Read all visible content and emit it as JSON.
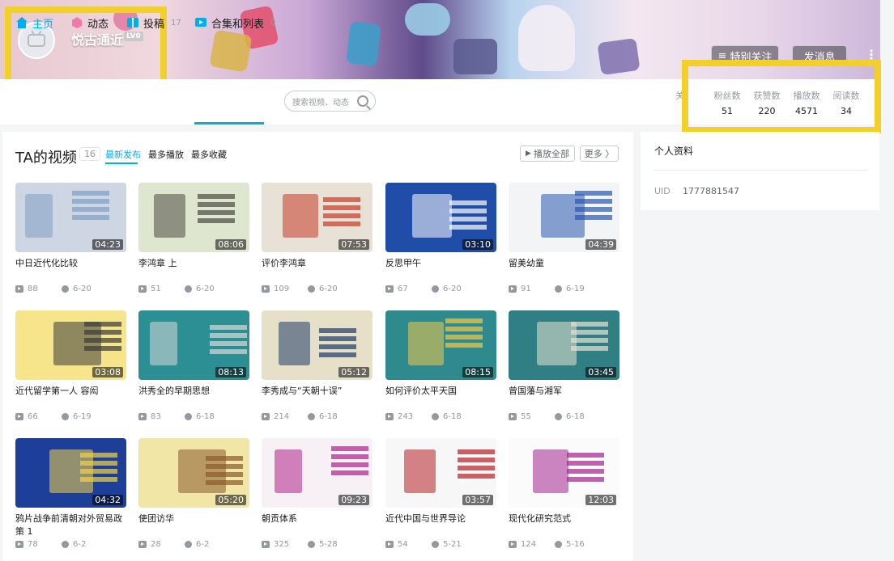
{
  "header": {
    "username": "悦古通近",
    "level": "LV0",
    "follow_label": "特别关注",
    "message_label": "发消息",
    "more_icon": "more-dots-icon"
  },
  "nav": {
    "items": [
      {
        "label": "主页",
        "icon": "home-icon",
        "count": ""
      },
      {
        "label": "动态",
        "icon": "dynamic-icon",
        "count": ""
      },
      {
        "label": "投稿",
        "icon": "upload-icon",
        "count": "17"
      },
      {
        "label": "合集和列表",
        "icon": "collection-icon",
        "count": "0"
      }
    ],
    "search_placeholder": "搜索视频、动态",
    "follow_cut": "关"
  },
  "stats": [
    {
      "label": "粉丝数",
      "value": "51"
    },
    {
      "label": "获赞数",
      "value": "220"
    },
    {
      "label": "播放数",
      "value": "4571"
    },
    {
      "label": "阅读数",
      "value": "34"
    }
  ],
  "videos_section": {
    "title": "TA的视频",
    "count": "16",
    "sort_tabs": [
      "最新发布",
      "最多播放",
      "最多收藏"
    ],
    "play_all_label": "播放全部",
    "more_label": "更多 〉"
  },
  "videos": [
    {
      "title": "中日近代化比较",
      "duration": "04:23",
      "plays": "88",
      "date": "6-20",
      "bg": "#cfd6e3",
      "accent": "#7f9fc7"
    },
    {
      "title": "李鸿章 上",
      "duration": "08:06",
      "plays": "51",
      "date": "6-20",
      "bg": "#dfe6cf",
      "accent": "#4a4a44"
    },
    {
      "title": "评价李鸿章",
      "duration": "07:53",
      "plays": "109",
      "date": "6-20",
      "bg": "#e8e2d6",
      "accent": "#c73b2a"
    },
    {
      "title": "反思甲午",
      "duration": "03:10",
      "plays": "67",
      "date": "6-20",
      "bg": "#1f4da8",
      "accent": "#ffffff"
    },
    {
      "title": "留美幼童",
      "duration": "04:39",
      "plays": "91",
      "date": "6-19",
      "bg": "#f2f4f6",
      "accent": "#2a58b0"
    },
    {
      "title": "近代留学第一人 容闳",
      "duration": "03:08",
      "plays": "66",
      "date": "6-19",
      "bg": "#f6e58a",
      "accent": "#3a3a3a"
    },
    {
      "title": "洪秀全的早期思想",
      "duration": "08:13",
      "plays": "83",
      "date": "6-18",
      "bg": "#2c8f93",
      "accent": "#d9d9d9"
    },
    {
      "title": "李秀成与“天朝十误”",
      "duration": "05:12",
      "plays": "214",
      "date": "6-18",
      "bg": "#e6e0c8",
      "accent": "#203a6a"
    },
    {
      "title": "如何评价太平天国",
      "duration": "08:15",
      "plays": "243",
      "date": "6-18",
      "bg": "#2f8a8e",
      "accent": "#f2c94c"
    },
    {
      "title": "曾国藩与湘军",
      "duration": "03:45",
      "plays": "55",
      "date": "6-18",
      "bg": "#2f7f84",
      "accent": "#e7e3d3"
    },
    {
      "title": "鸦片战争前清朝对外贸易政策 1",
      "duration": "04:32",
      "plays": "78",
      "date": "6-2",
      "bg": "#1d3f9a",
      "accent": "#f2d34a"
    },
    {
      "title": "使团访华",
      "duration": "05:20",
      "plays": "28",
      "date": "6-2",
      "bg": "#f2e6a6",
      "accent": "#8b5a2b"
    },
    {
      "title": "朝贡体系",
      "duration": "09:23",
      "plays": "325",
      "date": "5-28",
      "bg": "#f7f1f5",
      "accent": "#b0208a"
    },
    {
      "title": "近代中国与世界导论",
      "duration": "03:57",
      "plays": "54",
      "date": "5-21",
      "bg": "#f7f7f7",
      "accent": "#b8202a"
    },
    {
      "title": "现代化研究范式",
      "duration": "12:03",
      "plays": "124",
      "date": "5-16",
      "bg": "#fbfbfb",
      "accent": "#a32290"
    }
  ],
  "profile": {
    "title": "个人资料",
    "uid_label": "UID",
    "uid_value": "1777881547"
  },
  "colors": {
    "accent": "#00aeec",
    "highlight": "#f3cf2a"
  }
}
